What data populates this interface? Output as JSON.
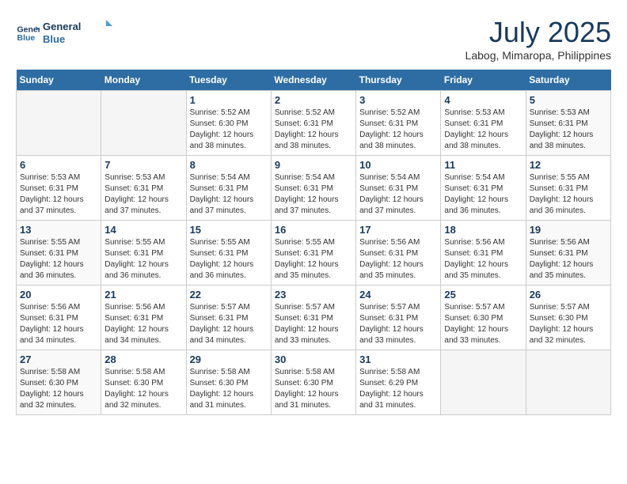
{
  "header": {
    "logo_line1": "General",
    "logo_line2": "Blue",
    "month": "July 2025",
    "location": "Labog, Mimaropa, Philippines"
  },
  "weekdays": [
    "Sunday",
    "Monday",
    "Tuesday",
    "Wednesday",
    "Thursday",
    "Friday",
    "Saturday"
  ],
  "weeks": [
    [
      {
        "day": "",
        "info": ""
      },
      {
        "day": "",
        "info": ""
      },
      {
        "day": "1",
        "info": "Sunrise: 5:52 AM\nSunset: 6:30 PM\nDaylight: 12 hours\nand 38 minutes."
      },
      {
        "day": "2",
        "info": "Sunrise: 5:52 AM\nSunset: 6:31 PM\nDaylight: 12 hours\nand 38 minutes."
      },
      {
        "day": "3",
        "info": "Sunrise: 5:52 AM\nSunset: 6:31 PM\nDaylight: 12 hours\nand 38 minutes."
      },
      {
        "day": "4",
        "info": "Sunrise: 5:53 AM\nSunset: 6:31 PM\nDaylight: 12 hours\nand 38 minutes."
      },
      {
        "day": "5",
        "info": "Sunrise: 5:53 AM\nSunset: 6:31 PM\nDaylight: 12 hours\nand 38 minutes."
      }
    ],
    [
      {
        "day": "6",
        "info": "Sunrise: 5:53 AM\nSunset: 6:31 PM\nDaylight: 12 hours\nand 37 minutes."
      },
      {
        "day": "7",
        "info": "Sunrise: 5:53 AM\nSunset: 6:31 PM\nDaylight: 12 hours\nand 37 minutes."
      },
      {
        "day": "8",
        "info": "Sunrise: 5:54 AM\nSunset: 6:31 PM\nDaylight: 12 hours\nand 37 minutes."
      },
      {
        "day": "9",
        "info": "Sunrise: 5:54 AM\nSunset: 6:31 PM\nDaylight: 12 hours\nand 37 minutes."
      },
      {
        "day": "10",
        "info": "Sunrise: 5:54 AM\nSunset: 6:31 PM\nDaylight: 12 hours\nand 37 minutes."
      },
      {
        "day": "11",
        "info": "Sunrise: 5:54 AM\nSunset: 6:31 PM\nDaylight: 12 hours\nand 36 minutes."
      },
      {
        "day": "12",
        "info": "Sunrise: 5:55 AM\nSunset: 6:31 PM\nDaylight: 12 hours\nand 36 minutes."
      }
    ],
    [
      {
        "day": "13",
        "info": "Sunrise: 5:55 AM\nSunset: 6:31 PM\nDaylight: 12 hours\nand 36 minutes."
      },
      {
        "day": "14",
        "info": "Sunrise: 5:55 AM\nSunset: 6:31 PM\nDaylight: 12 hours\nand 36 minutes."
      },
      {
        "day": "15",
        "info": "Sunrise: 5:55 AM\nSunset: 6:31 PM\nDaylight: 12 hours\nand 36 minutes."
      },
      {
        "day": "16",
        "info": "Sunrise: 5:55 AM\nSunset: 6:31 PM\nDaylight: 12 hours\nand 35 minutes."
      },
      {
        "day": "17",
        "info": "Sunrise: 5:56 AM\nSunset: 6:31 PM\nDaylight: 12 hours\nand 35 minutes."
      },
      {
        "day": "18",
        "info": "Sunrise: 5:56 AM\nSunset: 6:31 PM\nDaylight: 12 hours\nand 35 minutes."
      },
      {
        "day": "19",
        "info": "Sunrise: 5:56 AM\nSunset: 6:31 PM\nDaylight: 12 hours\nand 35 minutes."
      }
    ],
    [
      {
        "day": "20",
        "info": "Sunrise: 5:56 AM\nSunset: 6:31 PM\nDaylight: 12 hours\nand 34 minutes."
      },
      {
        "day": "21",
        "info": "Sunrise: 5:56 AM\nSunset: 6:31 PM\nDaylight: 12 hours\nand 34 minutes."
      },
      {
        "day": "22",
        "info": "Sunrise: 5:57 AM\nSunset: 6:31 PM\nDaylight: 12 hours\nand 34 minutes."
      },
      {
        "day": "23",
        "info": "Sunrise: 5:57 AM\nSunset: 6:31 PM\nDaylight: 12 hours\nand 33 minutes."
      },
      {
        "day": "24",
        "info": "Sunrise: 5:57 AM\nSunset: 6:31 PM\nDaylight: 12 hours\nand 33 minutes."
      },
      {
        "day": "25",
        "info": "Sunrise: 5:57 AM\nSunset: 6:30 PM\nDaylight: 12 hours\nand 33 minutes."
      },
      {
        "day": "26",
        "info": "Sunrise: 5:57 AM\nSunset: 6:30 PM\nDaylight: 12 hours\nand 32 minutes."
      }
    ],
    [
      {
        "day": "27",
        "info": "Sunrise: 5:58 AM\nSunset: 6:30 PM\nDaylight: 12 hours\nand 32 minutes."
      },
      {
        "day": "28",
        "info": "Sunrise: 5:58 AM\nSunset: 6:30 PM\nDaylight: 12 hours\nand 32 minutes."
      },
      {
        "day": "29",
        "info": "Sunrise: 5:58 AM\nSunset: 6:30 PM\nDaylight: 12 hours\nand 31 minutes."
      },
      {
        "day": "30",
        "info": "Sunrise: 5:58 AM\nSunset: 6:30 PM\nDaylight: 12 hours\nand 31 minutes."
      },
      {
        "day": "31",
        "info": "Sunrise: 5:58 AM\nSunset: 6:29 PM\nDaylight: 12 hours\nand 31 minutes."
      },
      {
        "day": "",
        "info": ""
      },
      {
        "day": "",
        "info": ""
      }
    ]
  ]
}
